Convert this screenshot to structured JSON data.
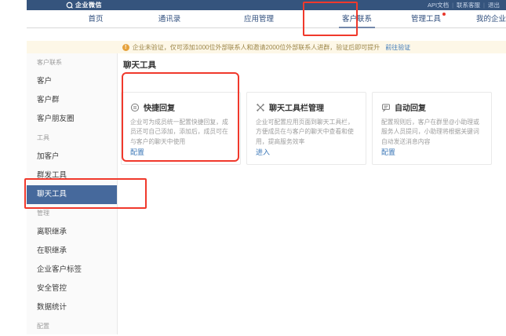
{
  "topbar": {
    "logo": "企业微信",
    "links": [
      "API文档",
      "联系客服",
      "退出"
    ]
  },
  "nav": {
    "tabs": [
      {
        "label": "首页"
      },
      {
        "label": "通讯录"
      },
      {
        "label": "应用管理"
      },
      {
        "label": "客户联系",
        "active": true,
        "annotated": true
      },
      {
        "label": "管理工具",
        "badge_dot": true
      },
      {
        "label": "我的企业"
      }
    ]
  },
  "notice": {
    "icon": "warning-icon",
    "text": "企业未验证，仅可添加1000位外部联系人和邀请2000位外部联系人进群，验证后即可提升",
    "link": "前往验证"
  },
  "sidebar": {
    "items": [
      {
        "label": "客户联系",
        "type": "header"
      },
      {
        "label": "客户",
        "type": "item"
      },
      {
        "label": "客户群",
        "type": "item"
      },
      {
        "label": "客户朋友圈",
        "type": "item"
      },
      {
        "label": "工具",
        "type": "header"
      },
      {
        "label": "加客户",
        "type": "item"
      },
      {
        "label": "群发工具",
        "type": "item"
      },
      {
        "label": "聊天工具",
        "type": "item",
        "selected": true,
        "annotated": true
      },
      {
        "label": "管理",
        "type": "header"
      },
      {
        "label": "离职继承",
        "type": "item"
      },
      {
        "label": "在职继承",
        "type": "item"
      },
      {
        "label": "企业客户标签",
        "type": "item"
      },
      {
        "label": "安全管控",
        "type": "item"
      },
      {
        "label": "数据统计",
        "type": "item"
      },
      {
        "label": "配置",
        "type": "header"
      }
    ]
  },
  "main": {
    "title": "聊天工具",
    "cards": [
      {
        "icon": "quick-reply-icon",
        "title": "快捷回复",
        "description": "企业可为成员统一配置快捷回复，成员还可自己添加，添加后，成员可在与客户的聊天中使用",
        "action": "配置",
        "annotated": true
      },
      {
        "icon": "chat-toolbar-icon",
        "title": "聊天工具栏管理",
        "description": "企业可配置应用页面到聊天工具栏，方便成员在与客户的聊天中查看和使用，提高服务效率",
        "action": "进入"
      },
      {
        "icon": "auto-reply-icon",
        "title": "自动回复",
        "description": "配置规则后，客户在群里@小助理或服务人员提问，小助理将根据关键词自动发送消息内容",
        "action": "配置"
      }
    ]
  },
  "colors": {
    "topbar_bg": "#35547d",
    "nav_text": "#2f4e7d",
    "active_underline": "#7388ab",
    "notice_bg": "#fdf7e7",
    "notice_text": "#9c8648",
    "notice_icon": "#e6a23c",
    "link_blue": "#3b77b7",
    "sidebar_selected_bg": "#46699c",
    "annotation_red": "#f0392c",
    "badge_red": "#e8372b"
  }
}
